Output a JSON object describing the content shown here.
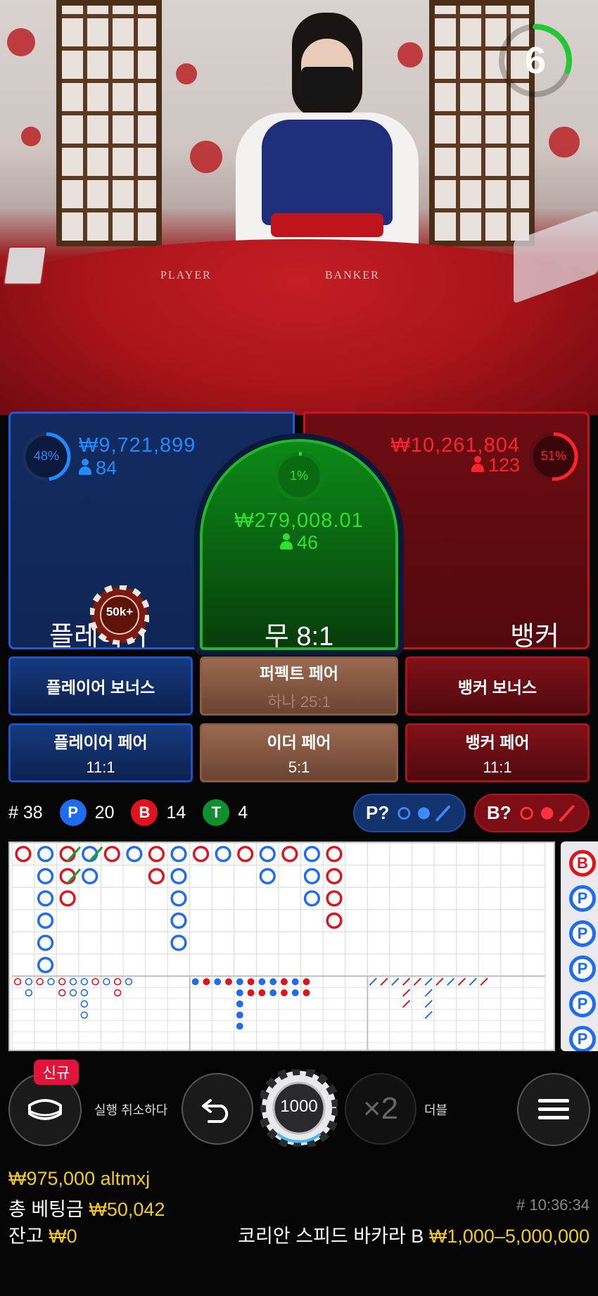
{
  "video": {
    "table_labels": {
      "player": "PLAYER",
      "banker": "BANKER"
    },
    "timer": {
      "seconds": "6",
      "progress": 0.3
    }
  },
  "player": {
    "percent": "48%",
    "amount": "₩9,721,899",
    "count": "84",
    "label": "플레이어",
    "color": "#1e8bff"
  },
  "banker": {
    "percent": "51%",
    "amount": "₩10,261,804",
    "count": "123",
    "label": "뱅커",
    "color": "#ff2230"
  },
  "tie": {
    "percent": "1%",
    "amount": "₩279,008.01",
    "count": "46",
    "label": "무 8:1",
    "color": "#2ee032"
  },
  "chip_on_player": "50k+",
  "side_bets": {
    "player_bonus": {
      "label": "플레이어 보너스"
    },
    "perfect_pair": {
      "label": "퍼펙트 페어",
      "sub": "하나 25:1"
    },
    "banker_bonus": {
      "label": "뱅커 보너스"
    },
    "player_pair": {
      "label": "플레이어 페어",
      "sub": "11:1"
    },
    "either_pair": {
      "label": "이더 페어",
      "sub": "5:1"
    },
    "banker_pair": {
      "label": "뱅커 페어",
      "sub": "11:1"
    }
  },
  "stats": {
    "round_label": "# 38",
    "player_badge": "P",
    "player_count": "20",
    "banker_badge": "B",
    "banker_count": "14",
    "tie_badge": "T",
    "tie_count": "4"
  },
  "predict": {
    "player": "P?",
    "banker": "B?"
  },
  "roadmap_side": [
    "B",
    "P",
    "P",
    "P",
    "P",
    "P"
  ],
  "controls": {
    "new_badge": "신규",
    "undo_label": "실행 취소하다",
    "chip_value": "1000",
    "double_symbol": "×2",
    "double_label": "더블"
  },
  "footer": {
    "balance_user": "₩975,000 altmxj",
    "total_bet_label": "총 베팅금",
    "total_bet_value": "₩50,042",
    "time": "# 10:36:34",
    "balance_label": "잔고",
    "balance_value": "₩0",
    "table_name": "코리안 스피드 바카라 B",
    "limits": "₩1,000–5,000,000"
  }
}
